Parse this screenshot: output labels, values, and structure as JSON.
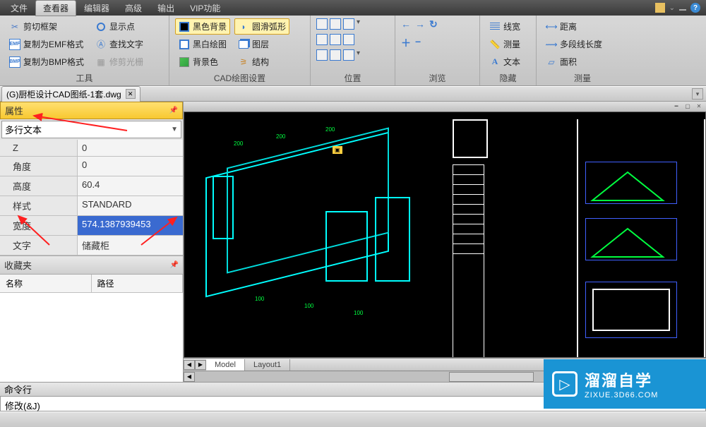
{
  "menubar": {
    "items": [
      {
        "label": "文件",
        "active": false
      },
      {
        "label": "查看器",
        "active": true
      },
      {
        "label": "编辑器",
        "active": false
      },
      {
        "label": "高级",
        "active": false
      },
      {
        "label": "输出",
        "active": false
      },
      {
        "label": "VIP功能",
        "active": false
      }
    ]
  },
  "ribbon": {
    "groups": [
      {
        "title": "工具",
        "cols": [
          [
            {
              "icon": "scissors",
              "label": "剪切框架"
            },
            {
              "icon": "emf",
              "label": "复制为EMF格式"
            },
            {
              "icon": "bmp",
              "label": "复制为BMP格式"
            }
          ],
          [
            {
              "icon": "point",
              "label": "显示点"
            },
            {
              "icon": "find",
              "label": "查找文字"
            },
            {
              "icon": "grid",
              "label": "修剪光栅",
              "disabled": true
            }
          ]
        ]
      },
      {
        "title": "CAD绘图设置",
        "cols": [
          [
            {
              "icon": "black-bg",
              "label": "黑色背景",
              "selected": true
            },
            {
              "icon": "white-bg",
              "label": "黑白绘图"
            },
            {
              "icon": "bg-color",
              "label": "背景色"
            }
          ],
          [
            {
              "icon": "arc",
              "label": "圆滑弧形",
              "selected": true
            },
            {
              "icon": "layer",
              "label": "图层"
            },
            {
              "icon": "struct",
              "label": "结构"
            }
          ]
        ]
      },
      {
        "title": "位置"
      },
      {
        "title": "浏览"
      },
      {
        "title": "隐藏",
        "cols": [
          [
            {
              "icon": "linew",
              "label": "线宽"
            },
            {
              "icon": "meas",
              "label": "测量"
            },
            {
              "icon": "text",
              "label": "文本"
            }
          ]
        ]
      },
      {
        "title": "测量",
        "cols": [
          [
            {
              "icon": "dist",
              "label": "距离"
            },
            {
              "icon": "dist",
              "label": "多段线长度"
            },
            {
              "icon": "dist",
              "label": "面积"
            }
          ]
        ]
      }
    ]
  },
  "tab": {
    "label": "(G)厨柜设计CAD图纸-1套.dwg"
  },
  "properties": {
    "panel_title": "属性",
    "object_type": "多行文本",
    "rows": [
      {
        "key": "Z",
        "val": "0"
      },
      {
        "key": "角度",
        "val": "0"
      },
      {
        "key": "高度",
        "val": "60.4"
      },
      {
        "key": "样式",
        "val": "STANDARD"
      },
      {
        "key": "宽度",
        "val": "574.1387939453",
        "selected": true
      },
      {
        "key": "文字",
        "val": "储藏柜"
      }
    ]
  },
  "favorites": {
    "panel_title": "收藏夹",
    "col1": "名称",
    "col2": "路径"
  },
  "layout_tabs": [
    "Model",
    "Layout1"
  ],
  "command": {
    "label": "命令行",
    "text": "修改(&J)"
  },
  "watermark": {
    "title": "溜溜自学",
    "url": "ZIXUE.3D66.COM"
  }
}
